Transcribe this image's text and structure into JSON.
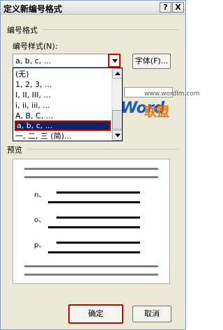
{
  "window": {
    "title": "定义新编号格式",
    "help": "?",
    "close": "X"
  },
  "group": {
    "legend": "编号格式"
  },
  "style": {
    "label": "编号样式(N):",
    "value": "a, b, c, ..."
  },
  "font_button": "字体(F)...",
  "dropdown_items": [
    "(无)",
    "1, 2, 3, ...",
    "I, II, III, ...",
    "i, ii, iii, ...",
    "A, B, C, ...",
    "a, b, c, ...",
    "一, 二, 三 (简)..."
  ],
  "selected_index": 5,
  "watermark": {
    "url": "www.wordlm.com",
    "word": "Word",
    "lm": "联盟"
  },
  "preview": {
    "legend": "预览",
    "markers": [
      "n、",
      "o、",
      "p、"
    ]
  },
  "buttons": {
    "ok": "确定",
    "cancel": "取消"
  }
}
